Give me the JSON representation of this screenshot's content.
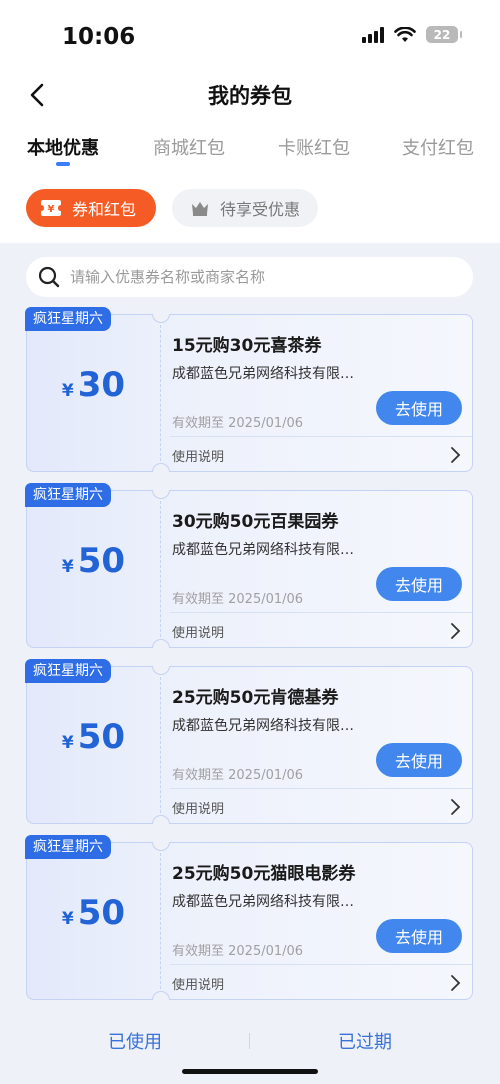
{
  "status_bar": {
    "time": "10:06",
    "battery": "22"
  },
  "nav": {
    "title": "我的券包"
  },
  "tabs": [
    {
      "label": "本地优惠",
      "active": true
    },
    {
      "label": "商城红包",
      "active": false
    },
    {
      "label": "卡账红包",
      "active": false
    },
    {
      "label": "支付红包",
      "active": false
    }
  ],
  "filter_chips": [
    {
      "label": "券和红包",
      "active": true
    },
    {
      "label": "待享受优惠",
      "active": false
    }
  ],
  "search": {
    "placeholder": "请输入优惠券名称或商家名称"
  },
  "coupons": [
    {
      "tag": "疯狂星期六",
      "currency": "¥",
      "amount": "30",
      "title": "15元购30元喜茶券",
      "merchant": "成都蓝色兄弟网络科技有限…",
      "expiry": "有效期至 2025/01/06",
      "button": "去使用",
      "instructions": "使用说明"
    },
    {
      "tag": "疯狂星期六",
      "currency": "¥",
      "amount": "50",
      "title": "30元购50元百果园券",
      "merchant": "成都蓝色兄弟网络科技有限…",
      "expiry": "有效期至 2025/01/06",
      "button": "去使用",
      "instructions": "使用说明"
    },
    {
      "tag": "疯狂星期六",
      "currency": "¥",
      "amount": "50",
      "title": "25元购50元肯德基券",
      "merchant": "成都蓝色兄弟网络科技有限…",
      "expiry": "有效期至 2025/01/06",
      "button": "去使用",
      "instructions": "使用说明"
    },
    {
      "tag": "疯狂星期六",
      "currency": "¥",
      "amount": "50",
      "title": "25元购50元猫眼电影券",
      "merchant": "成都蓝色兄弟网络科技有限…",
      "expiry": "有效期至 2025/01/06",
      "button": "去使用",
      "instructions": "使用说明"
    }
  ],
  "bottom_links": {
    "used": "已使用",
    "expired": "已过期"
  },
  "colors": {
    "accent": "#f45b25",
    "primary": "#4287ee",
    "amount": "#2264d6",
    "tag": "#2f6de6"
  }
}
